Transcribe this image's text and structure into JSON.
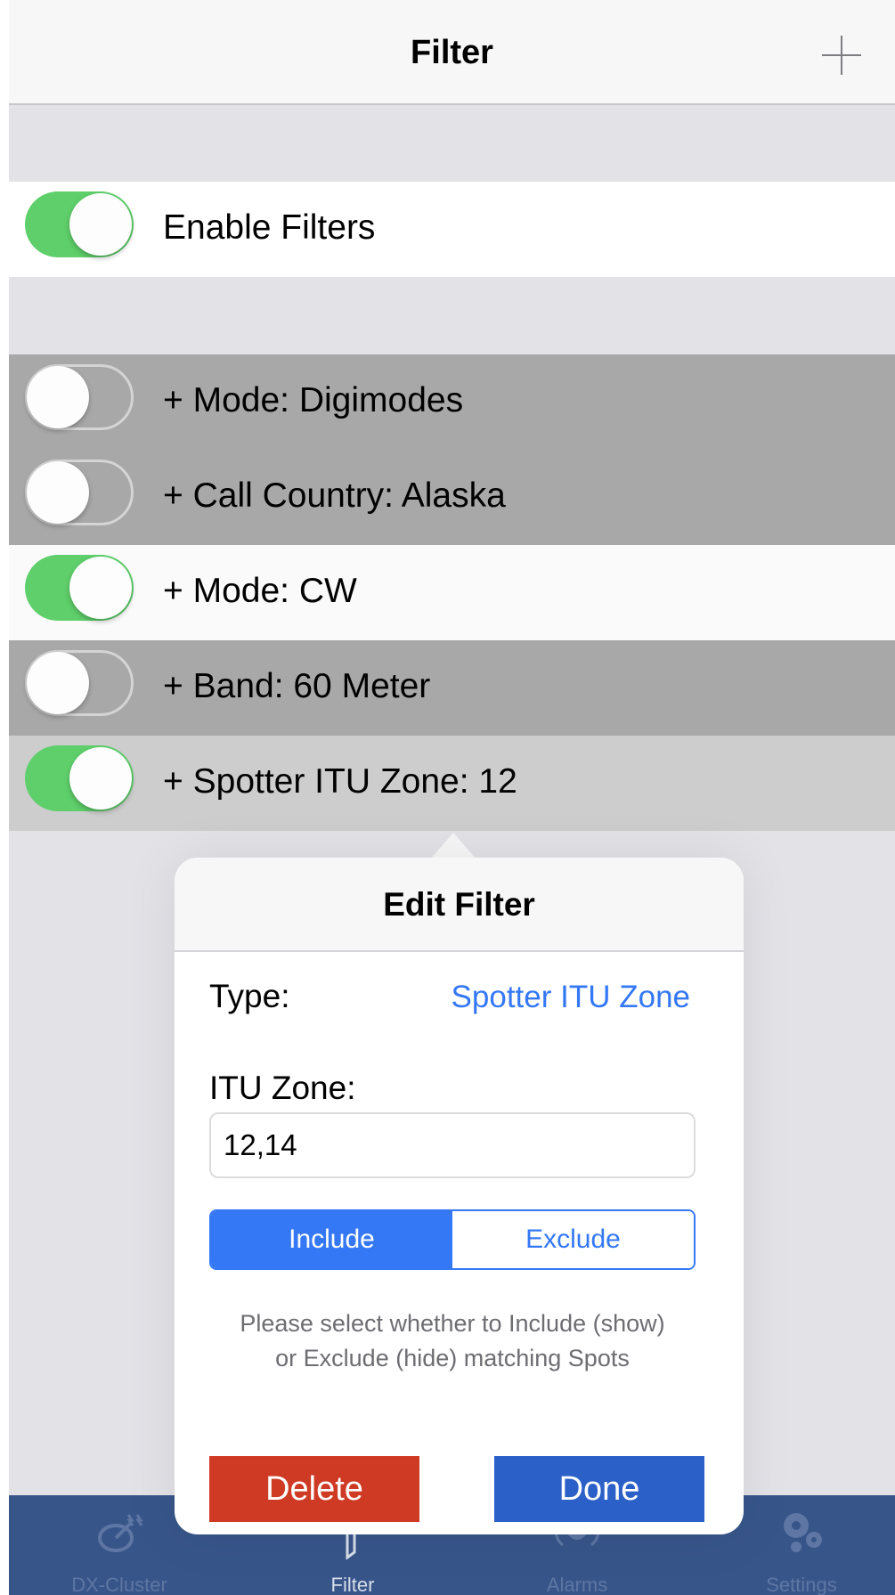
{
  "nav": {
    "title": "Filter",
    "add_icon": "plus-icon"
  },
  "enable": {
    "label": "Enable Filters",
    "on": true
  },
  "filters": [
    {
      "label": "+ Mode: Digimodes",
      "on": false
    },
    {
      "label": "+ Call Country: Alaska",
      "on": false
    },
    {
      "label": "+ Mode: CW",
      "on": true
    },
    {
      "label": "+ Band: 60 Meter",
      "on": false
    },
    {
      "label": "+ Spotter ITU Zone: 12",
      "on": true
    }
  ],
  "popover": {
    "title": "Edit Filter",
    "type_label": "Type:",
    "type_value": "Spotter ITU Zone",
    "zone_label": "ITU Zone:",
    "zone_value": "12,14",
    "include_label": "Include",
    "exclude_label": "Exclude",
    "selected": "Include",
    "help": "Please select whether to Include (show) or Exclude (hide) matching Spots",
    "delete_label": "Delete",
    "done_label": "Done"
  },
  "tabs": [
    {
      "label": "DX-Cluster",
      "icon": "satellite-dish-icon",
      "active": false
    },
    {
      "label": "Filter",
      "icon": "funnel-icon",
      "active": true
    },
    {
      "label": "Alarms",
      "icon": "bell-icon",
      "active": false
    },
    {
      "label": "Settings",
      "icon": "gears-icon",
      "active": false
    }
  ],
  "colors": {
    "toggle_on": "#5ecf6a",
    "accent_blue": "#3478f6",
    "delete_red": "#cf3a24",
    "done_blue": "#2b60c8",
    "tabbar_bg": "#38558a"
  }
}
